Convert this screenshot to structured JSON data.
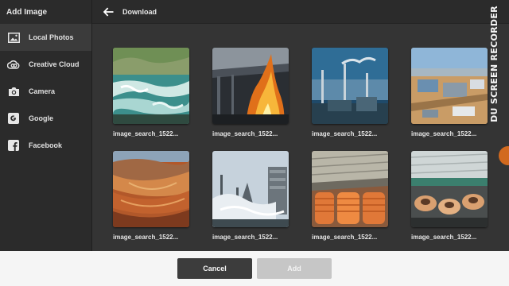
{
  "sidebar": {
    "title": "Add Image",
    "items": [
      {
        "label": "Local Photos",
        "icon": "photo-icon"
      },
      {
        "label": "Creative Cloud",
        "icon": "creative-cloud-icon"
      },
      {
        "label": "Camera",
        "icon": "camera-icon"
      },
      {
        "label": "Google",
        "icon": "google-icon"
      },
      {
        "label": "Facebook",
        "icon": "facebook-icon"
      }
    ]
  },
  "topbar": {
    "location": "Download"
  },
  "grid": {
    "images": [
      {
        "caption": "image_search_1522...",
        "scene": "river-rapids"
      },
      {
        "caption": "image_search_1522...",
        "scene": "furnace-fire"
      },
      {
        "caption": "image_search_1522...",
        "scene": "factory-smokestacks"
      },
      {
        "caption": "image_search_1522...",
        "scene": "aerial-plant"
      },
      {
        "caption": "image_search_1522...",
        "scene": "open-pit-mine"
      },
      {
        "caption": "image_search_1522...",
        "scene": "industrial-steam"
      },
      {
        "caption": "image_search_1522...",
        "scene": "copper-coils-warehouse"
      },
      {
        "caption": "image_search_1522...",
        "scene": "cable-spools-factory"
      }
    ]
  },
  "footer": {
    "cancel_label": "Cancel",
    "add_label": "Add"
  },
  "watermark": "DU SCREEN RECORDER",
  "colors": {
    "panel": "#2b2b2b",
    "grid_bg": "#343434",
    "footer_bg": "#f5f5f5",
    "cancel_bg": "#3c3c3c",
    "add_bg_disabled": "#c6c6c6"
  }
}
